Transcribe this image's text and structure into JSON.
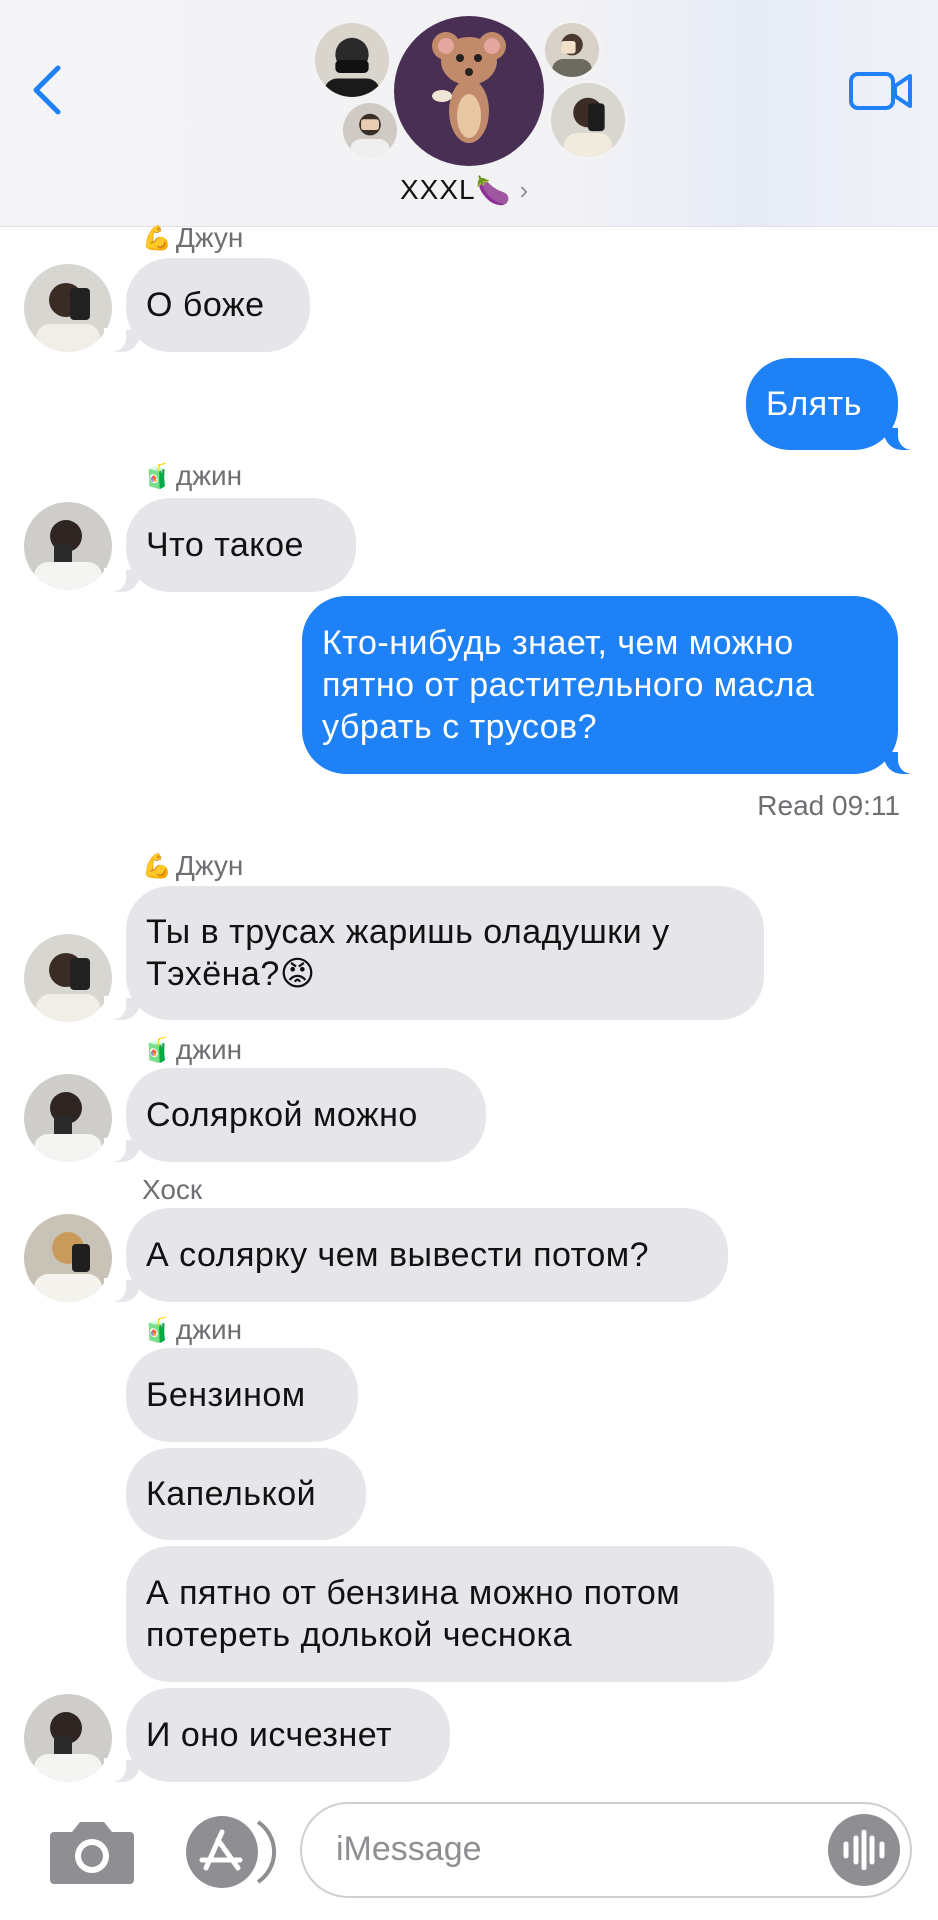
{
  "header": {
    "group_name": "XXXL",
    "group_emoji": "🍆",
    "chevron": "›",
    "back_icon": "chevron-left-icon",
    "video_icon": "video-camera-icon",
    "accent_color": "#1e82f6"
  },
  "messages": [
    {
      "sender": "Джун",
      "sender_emoji": "💪",
      "text": "О боже",
      "direction": "in"
    },
    {
      "text": "Блять",
      "direction": "out"
    },
    {
      "sender": "джин",
      "sender_emoji": "🧃",
      "text": "Что такое",
      "direction": "in"
    },
    {
      "text_lines": [
        "Кто-нибудь знает,  чем можно",
        "пятно от растительного масла",
        "убрать с трусов?"
      ],
      "direction": "out"
    },
    {
      "read_label": "Read",
      "read_time": "09:11"
    },
    {
      "sender": "Джун",
      "sender_emoji": "💪",
      "text_lines": [
        "Ты в трусах жаришь оладушки  у",
        "Тэхёна?😡"
      ],
      "direction": "in"
    },
    {
      "sender": "джин",
      "sender_emoji": "🧃",
      "text": "Соляркой можно",
      "direction": "in"
    },
    {
      "sender": "Хоск",
      "text": "А солярку чем вывести потом?",
      "direction": "in"
    },
    {
      "sender": "джин",
      "sender_emoji": "🧃",
      "text": "Бензином",
      "direction": "in"
    },
    {
      "text": "Капелькой",
      "direction": "in"
    },
    {
      "text_lines": [
        "А пятно от бензина можно потом",
        "потереть  долькой чеснока"
      ],
      "direction": "in"
    },
    {
      "text": "И оно исчезнет",
      "direction": "in"
    }
  ],
  "composer": {
    "placeholder": "iMessage",
    "camera_icon": "camera-icon",
    "apps_icon": "app-store-icon",
    "audio_icon": "audio-waveform-icon"
  }
}
